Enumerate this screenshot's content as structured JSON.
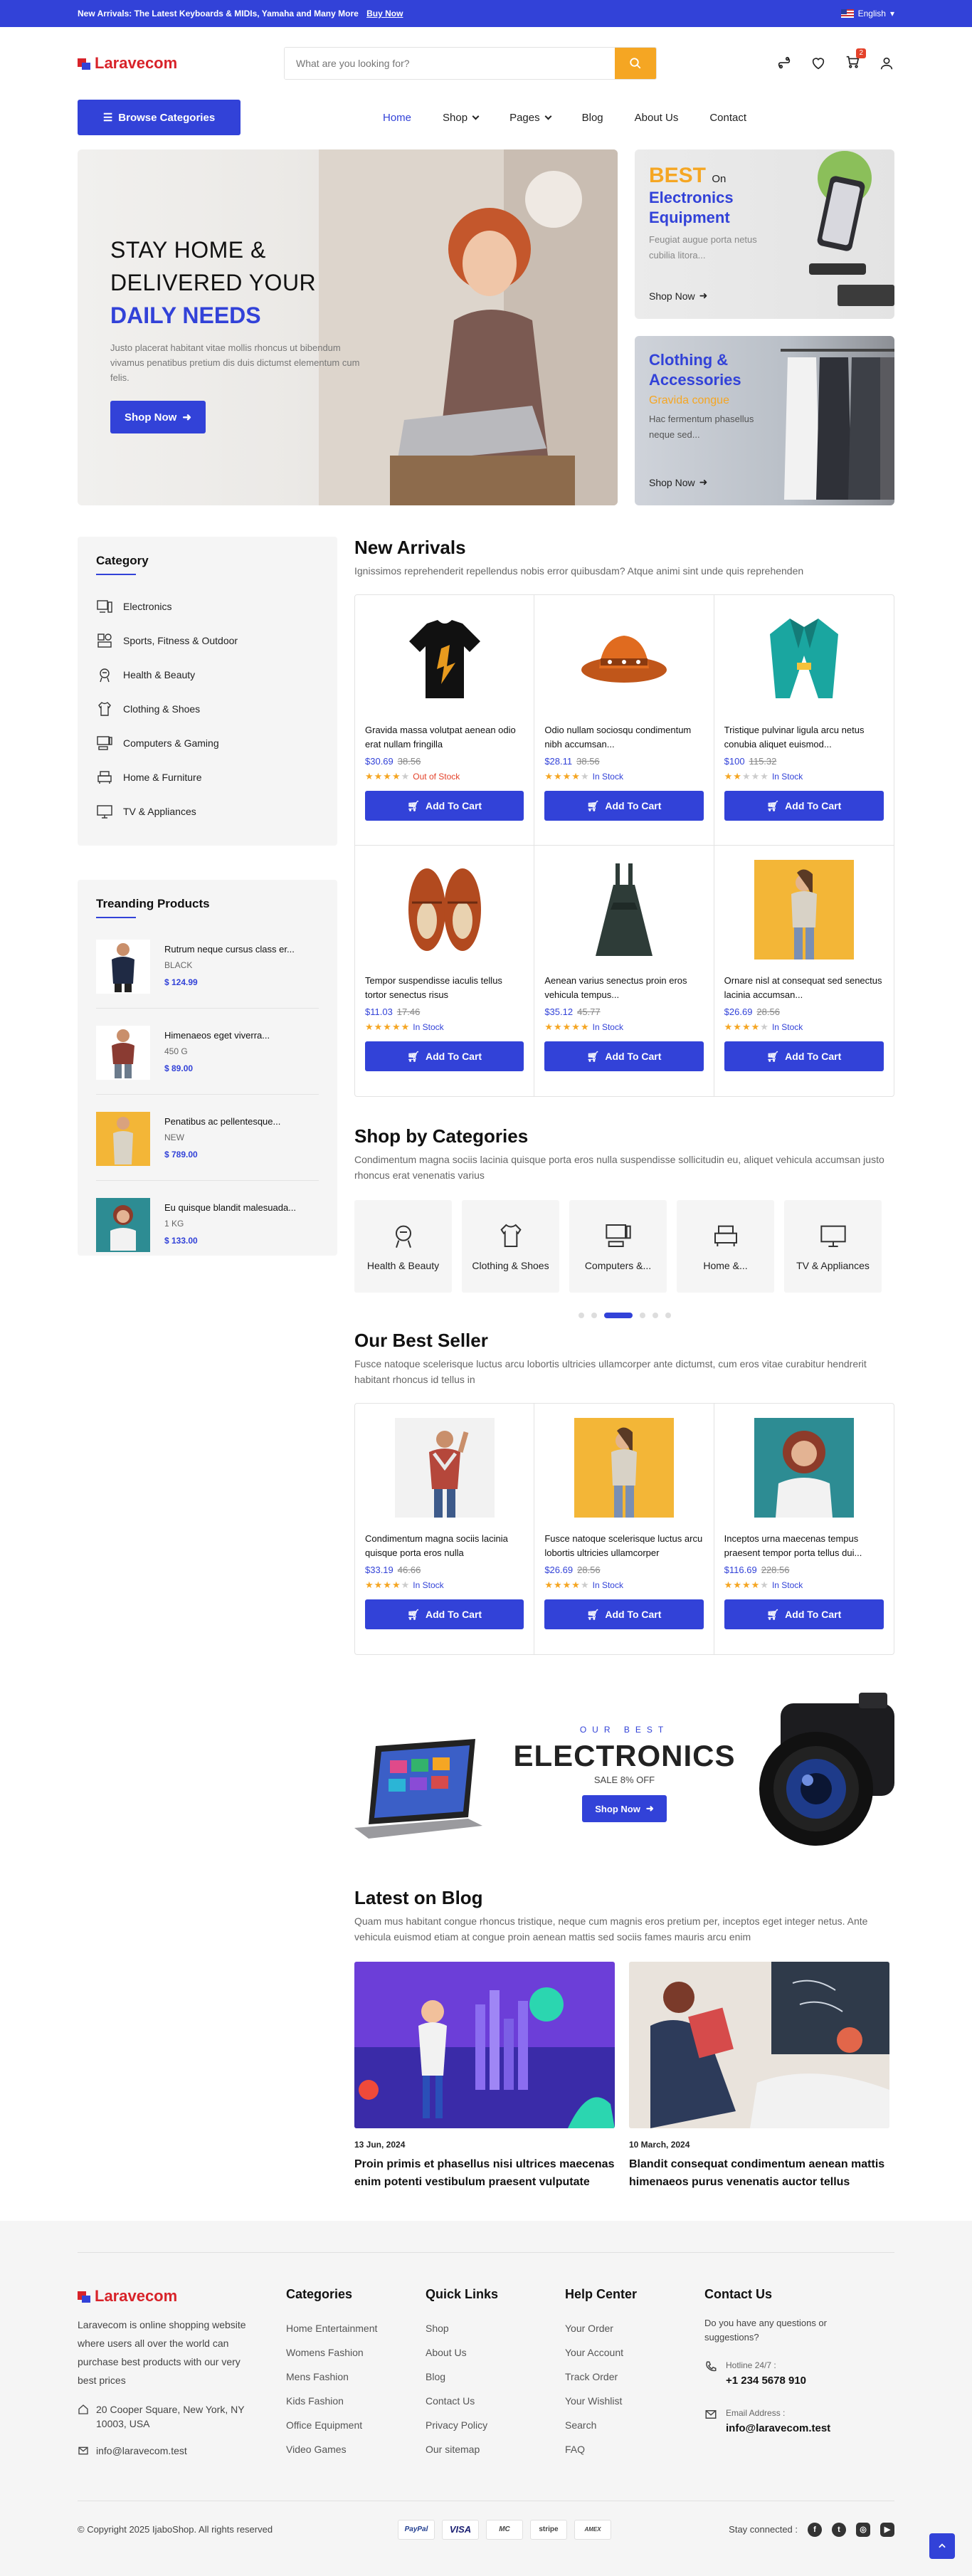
{
  "topbar": {
    "announcement": "New Arrivals: The Latest Keyboards & MIDIs, Yamaha and Many More",
    "buy_now": "Buy Now",
    "language": "English"
  },
  "header": {
    "logo": "Laravecom",
    "search_placeholder": "What are you looking for?",
    "cart_count": "2"
  },
  "nav": {
    "browse": "Browse Categories",
    "items": [
      "Home",
      "Shop",
      "Pages",
      "Blog",
      "About Us",
      "Contact"
    ]
  },
  "hero": {
    "line1": "STAY HOME &",
    "line2": "DELIVERED YOUR",
    "line3": "DAILY NEEDS",
    "desc": "Justo placerat habitant vitae mollis rhoncus ut bibendum vivamus penatibus pretium dis duis dictumst elementum cum felis.",
    "button": "Shop Now"
  },
  "promo1": {
    "best": "BEST",
    "on": "On",
    "title": "Electronics Equipment",
    "desc": "Feugiat augue porta netus cubilia litora...",
    "link": "Shop Now"
  },
  "promo2": {
    "title": "Clothing & Accessories",
    "sub": "Gravida congue",
    "desc": "Hac fermentum phasellus neque sed...",
    "link": "Shop Now"
  },
  "category_box": {
    "title": "Category",
    "items": [
      "Electronics",
      "Sports, Fitness & Outdoor",
      "Health & Beauty",
      "Clothing & Shoes",
      "Computers & Gaming",
      "Home & Furniture",
      "TV & Appliances"
    ]
  },
  "trending": {
    "title": "Treanding Products",
    "items": [
      {
        "name": "Rutrum neque cursus class er...",
        "variant": "BLACK",
        "price": "$ 124.99"
      },
      {
        "name": "Himenaeos eget viverra...",
        "variant": "450 G",
        "price": "$ 89.00"
      },
      {
        "name": "Penatibus ac pellentesque...",
        "variant": "NEW",
        "price": "$ 789.00"
      },
      {
        "name": "Eu quisque blandit malesuada...",
        "variant": "1 KG",
        "price": "$ 133.00"
      }
    ]
  },
  "new_arrivals": {
    "title": "New Arrivals",
    "subtitle": "Ignissimos reprehenderit repellendus nobis error quibusdam? Atque animi sint unde quis reprehenden",
    "add_to_cart": "Add To Cart",
    "products": [
      {
        "name": "Gravida massa volutpat aenean odio erat nullam fringilla",
        "price": "$30.69",
        "old": "38.56",
        "rating": 4,
        "stock": "Out of Stock"
      },
      {
        "name": "Odio nullam sociosqu condimentum nibh accumsan...",
        "price": "$28.11",
        "old": "38.56",
        "rating": 4,
        "stock": "In Stock"
      },
      {
        "name": "Tristique pulvinar ligula arcu netus conubia aliquet euismod...",
        "price": "$100",
        "old": "115.32",
        "rating": 2,
        "stock": "In Stock"
      },
      {
        "name": "Tempor suspendisse iaculis tellus tortor senectus risus",
        "price": "$11.03",
        "old": "17.46",
        "rating": 5,
        "stock": "In Stock"
      },
      {
        "name": "Aenean varius senectus proin eros vehicula tempus...",
        "price": "$35.12",
        "old": "45.77",
        "rating": 5,
        "stock": "In Stock"
      },
      {
        "name": "Ornare nisl at consequat sed senectus lacinia accumsan...",
        "price": "$26.69",
        "old": "28.56",
        "rating": 4,
        "stock": "In Stock"
      }
    ]
  },
  "shop_categories": {
    "title": "Shop by Categories",
    "subtitle": "Condimentum magna sociis lacinia quisque porta eros nulla suspendisse sollicitudin eu, aliquet vehicula accumsan justo rhoncus erat venenatis varius",
    "items": [
      "Health & Beauty",
      "Clothing & Shoes",
      "Computers &...",
      "Home &...",
      "TV & Appliances"
    ]
  },
  "best_seller": {
    "title": "Our Best Seller",
    "subtitle": "Fusce natoque scelerisque luctus arcu lobortis ultricies ullamcorper ante dictumst, cum eros vitae curabitur hendrerit habitant rhoncus id tellus in",
    "add_to_cart": "Add To Cart",
    "products": [
      {
        "name": "Condimentum magna sociis lacinia quisque porta eros nulla",
        "price": "$33.19",
        "old": "46.66",
        "rating": 4,
        "stock": "In Stock"
      },
      {
        "name": "Fusce natoque scelerisque luctus arcu lobortis ultricies ullamcorper",
        "price": "$26.69",
        "old": "28.56",
        "rating": 4,
        "stock": "In Stock"
      },
      {
        "name": "Inceptos urna maecenas tempus praesent tempor porta tellus dui...",
        "price": "$116.69",
        "old": "228.56",
        "rating": 4,
        "stock": "In Stock"
      }
    ]
  },
  "banner": {
    "our": "OUR BEST",
    "big": "ELECTRONICS",
    "sale": "SALE 8% OFF",
    "button": "Shop Now"
  },
  "blog": {
    "title": "Latest on Blog",
    "subtitle": "Quam mus habitant congue rhoncus tristique, neque cum magnis eros pretium per, inceptos eget integer netus. Ante vehicula euismod etiam at congue proin aenean mattis sed sociis fames mauris arcu enim",
    "posts": [
      {
        "date": "13 Jun, 2024",
        "title": "Proin primis et phasellus nisi ultrices maecenas enim potenti vestibulum praesent vulputate"
      },
      {
        "date": "10 March, 2024",
        "title": "Blandit consequat condimentum aenean mattis himenaeos purus venenatis auctor tellus"
      }
    ]
  },
  "footer": {
    "logo": "Laravecom",
    "desc": "Laravecom is online shopping website where users all over the world can purchase best products with our very best prices",
    "address": "20 Cooper Square, New York, NY 10003, USA",
    "email": "info@laravecom.test",
    "categories": {
      "title": "Categories",
      "links": [
        "Home Entertainment",
        "Womens Fashion",
        "Mens Fashion",
        "Kids Fashion",
        "Office Equipment",
        "Video Games"
      ]
    },
    "quick": {
      "title": "Quick Links",
      "links": [
        "Shop",
        "About Us",
        "Blog",
        "Contact Us",
        "Privacy Policy",
        "Our sitemap"
      ]
    },
    "help": {
      "title": "Help Center",
      "links": [
        "Your Order",
        "Your Account",
        "Track Order",
        "Your Wishlist",
        "Search",
        "FAQ"
      ]
    },
    "contact": {
      "title": "Contact Us",
      "question": "Do you have any questions or suggestions?",
      "hotline_label": "Hotline 24/7 :",
      "hotline": "+1 234 5678 910",
      "email_label": "Email Address :",
      "email": "info@laravecom.test"
    },
    "copyright": "© Copyright 2025 IjaboShop. All rights reserved",
    "payments": [
      "PayPal",
      "VISA",
      "MC",
      "stripe",
      "AMEX"
    ],
    "stay": "Stay connected :"
  },
  "colors": {
    "primary": "#3242d8",
    "accent": "#f5a623",
    "danger": "#e4422a"
  }
}
